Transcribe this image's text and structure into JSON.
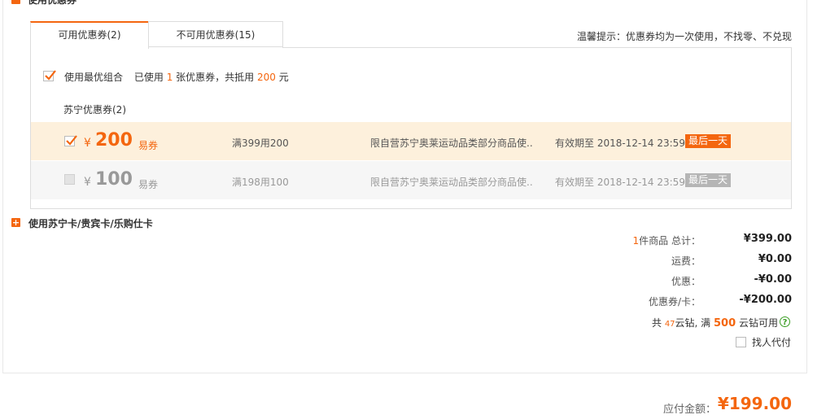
{
  "coupon_section": {
    "title": "使用优惠券",
    "tabs": [
      {
        "label": "可用优惠券(2)",
        "active": true
      },
      {
        "label": "不可用优惠券(15)",
        "active": false
      }
    ],
    "tip": "温馨提示：优惠券均为一次使用，不找零、不兑现",
    "best_combo": {
      "label": "使用最优组合",
      "used_prefix": "已使用",
      "used_count": "1",
      "used_mid": "张优惠券，共抵用",
      "used_amount": "200",
      "used_suffix": "元",
      "checked": true
    },
    "group_label": "苏宁优惠券(2)",
    "coupons": [
      {
        "checked": true,
        "enabled": true,
        "currency": "¥",
        "amount": "200",
        "type": "易券",
        "rule": "满399用200",
        "scope": "限自营苏宁奥莱运动品类部分商品使..",
        "validity": "有效期至 2018-12-14 23:59",
        "badge": "最后一天"
      },
      {
        "checked": false,
        "enabled": false,
        "currency": "¥",
        "amount": "100",
        "type": "易券",
        "rule": "满198用100",
        "scope": "限自营苏宁奥莱运动品类部分商品使..",
        "validity": "有效期至 2018-12-14 23:59",
        "badge": "最后一天"
      }
    ]
  },
  "card_section": {
    "title": "使用苏宁卡/贵宾卡/乐购仕卡"
  },
  "summary": {
    "items_count": "1",
    "items_label": "件商品  总计：",
    "items_value": "¥399.00",
    "shipping_label": "运费：",
    "shipping_value": "¥0.00",
    "discount_label": "优惠：",
    "discount_value": "-¥0.00",
    "coupon_label": "优惠券/卡：",
    "coupon_value": "-¥200.00",
    "diamond_prefix": "共",
    "diamond_count": "47",
    "diamond_mid": "云钻, 满",
    "diamond_threshold": "500",
    "diamond_suffix": "云钻可用",
    "proxy_pay_label": "找人代付",
    "total_label": "应付金额：",
    "total_value": "¥199.00"
  },
  "colors": {
    "accent": "#f4660f",
    "selected_row_bg": "#fdf0dc",
    "disabled_row_bg": "#f6f6f6",
    "disabled_badge": "#b5b5b5",
    "help_green": "#3a9d23"
  }
}
